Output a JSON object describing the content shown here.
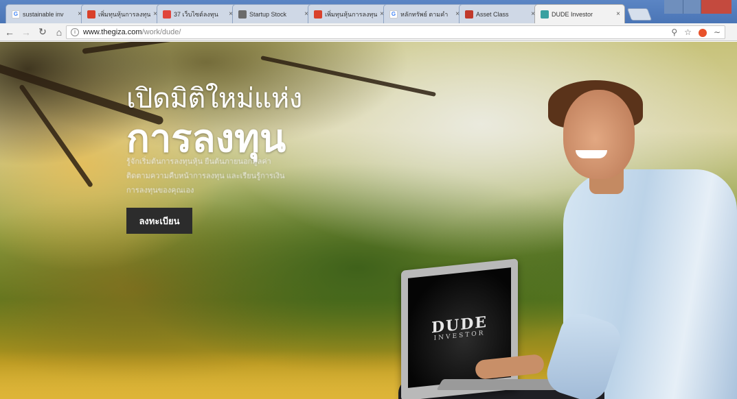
{
  "browser": {
    "tabs": [
      {
        "title": "sustainable inv",
        "favicon": "google-icon",
        "color": "#ffffff",
        "active": false
      },
      {
        "title": "เพิ่มทุนหุ้นการลงทุน",
        "favicon": "red-app-icon",
        "color": "#d9412b",
        "active": false
      },
      {
        "title": "37 เว็บไซต์ลงทุน",
        "favicon": "red-circle-icon",
        "color": "#e0463c",
        "active": false
      },
      {
        "title": "Startup Stock",
        "favicon": "image-icon",
        "color": "#6b6b6b",
        "active": false
      },
      {
        "title": "เพิ่มทุนหุ้นการลงทุน",
        "favicon": "red-app-icon",
        "color": "#d9412b",
        "active": false
      },
      {
        "title": "หลักทรัพย์ ตามคำ",
        "favicon": "google-icon",
        "color": "#ffffff",
        "active": false
      },
      {
        "title": "Asset Class",
        "favicon": "red-app-icon",
        "color": "#c0392b",
        "active": false
      },
      {
        "title": "DUDE Investor",
        "favicon": "dude-icon",
        "color": "#3aa0a0",
        "active": true
      }
    ],
    "url_host": "www.thegiza.com",
    "url_path": "/work/dude/"
  },
  "hero": {
    "title_line1": "เปิดมิติใหม่แห่ง",
    "title_line2": "การลงทุน",
    "description": "รู้จักเริ่มต้นการลงทุนหุ้น ยืนต้นภายนอกมูลค่า ติดตามความคืบหน้าการลงทุน และเรียนรู้การเงิน การลงทุนของคุณเอง",
    "cta_label": "ลงทะเบียน"
  },
  "laptop": {
    "brand_line1": "DUDE",
    "brand_line2": "INVESTOR"
  }
}
